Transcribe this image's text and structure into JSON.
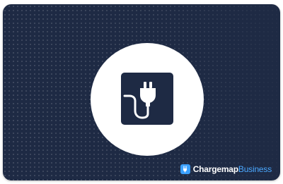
{
  "card": {
    "icon": "plug-icon",
    "brand": {
      "logo_icon": "chargemap-logo-icon",
      "name": "Chargemap",
      "suffix": "Business",
      "accent_color": "#3aa0ff"
    },
    "colors": {
      "background": "#1e2a44",
      "circle": "#ffffff"
    }
  }
}
